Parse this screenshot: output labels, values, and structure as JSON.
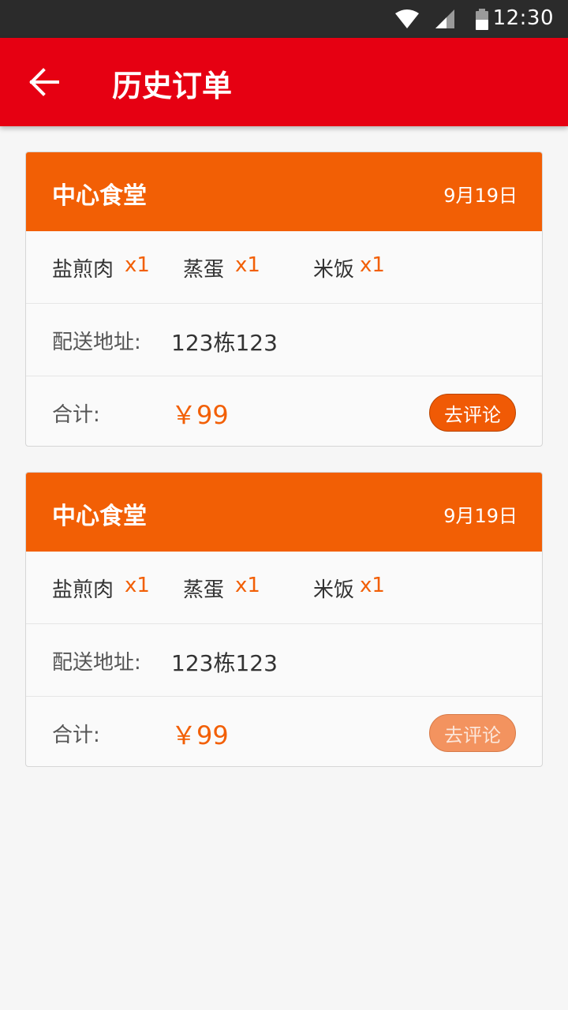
{
  "status_bar": {
    "time": "12:30"
  },
  "app_bar": {
    "title": "历史订单",
    "back_icon": "arrow-left-icon"
  },
  "labels": {
    "address_label": "配送地址:",
    "total_label": "合计:",
    "review_button": "去评论"
  },
  "orders": [
    {
      "shop": "中心食堂",
      "date": "9月19日",
      "items": [
        {
          "name": "盐煎肉",
          "qty": "x1"
        },
        {
          "name": "蒸蛋",
          "qty": "x1"
        },
        {
          "name": "米饭",
          "qty": "x1"
        }
      ],
      "address": "123栋123",
      "total": "￥99",
      "review_enabled": true
    },
    {
      "shop": "中心食堂",
      "date": "9月19日",
      "items": [
        {
          "name": "盐煎肉",
          "qty": "x1"
        },
        {
          "name": "蒸蛋",
          "qty": "x1"
        },
        {
          "name": "米饭",
          "qty": "x1"
        }
      ],
      "address": "123栋123",
      "total": "￥99",
      "review_enabled": false
    }
  ],
  "colors": {
    "app_bar": "#e60012",
    "card_header": "#f25f05",
    "accent": "#f25f05"
  }
}
